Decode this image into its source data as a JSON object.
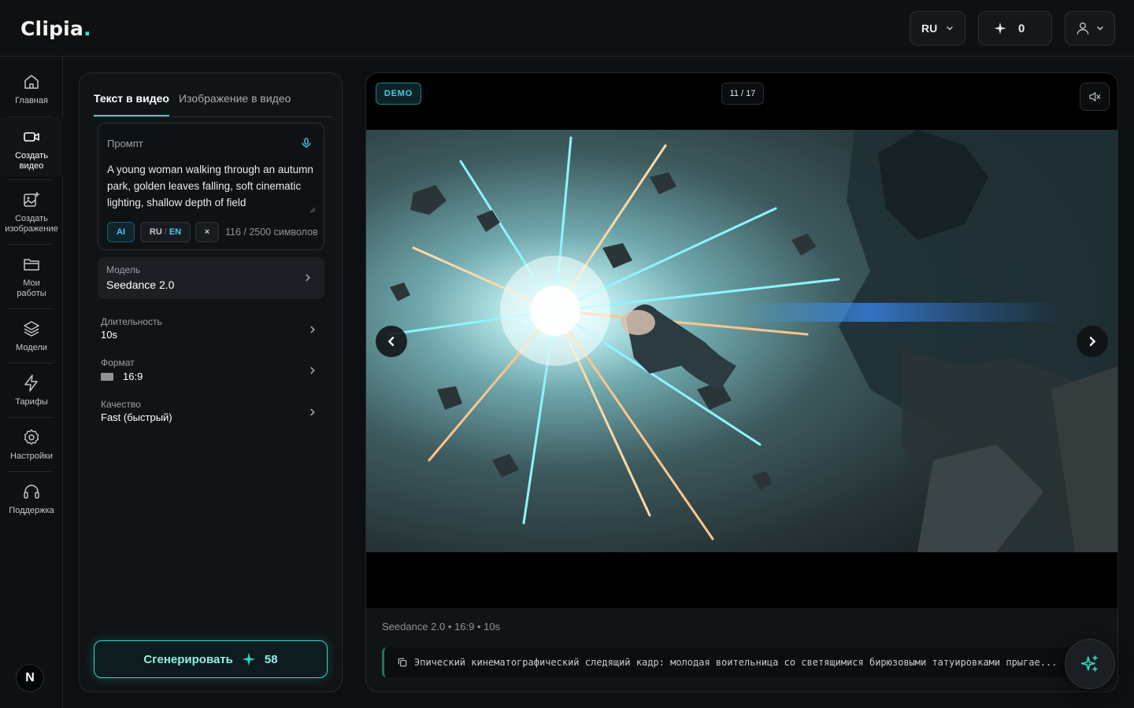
{
  "app": {
    "logo": "Clipia",
    "logo_dot": "."
  },
  "header": {
    "language": "RU",
    "credits": "0",
    "icons": [
      "chevron-down-icon",
      "sparkle-icon",
      "user-icon"
    ]
  },
  "sidebar": {
    "items": [
      {
        "label": "Главная",
        "icon": "home-icon"
      },
      {
        "label": "Создать видео",
        "icon": "video-camera-icon"
      },
      {
        "label": "Создать изображение",
        "icon": "image-add-icon"
      },
      {
        "label": "Мои работы",
        "icon": "folder-icon"
      },
      {
        "label": "Модели",
        "icon": "layers-icon"
      },
      {
        "label": "Тарифы",
        "icon": "lightning-icon"
      },
      {
        "label": "Настройки",
        "icon": "gear-icon"
      },
      {
        "label": "Поддержка",
        "icon": "headset-icon"
      }
    ],
    "avatar": "N"
  },
  "panel": {
    "tabs": [
      {
        "label": "Текст в видео",
        "active": true
      },
      {
        "label": "Изображение в видео",
        "active": false
      }
    ],
    "prompt": {
      "label": "Промпт",
      "text": "A young woman walking through an autumn park, golden leaves falling, soft cinematic lighting, shallow depth of field",
      "chips": {
        "ai": "AI",
        "ru": "RU",
        "sep": "/",
        "en": "EN",
        "clear": "×"
      },
      "char_count": "116 / 2500 символов"
    },
    "model": {
      "label": "Модель",
      "value": "Seedance 2.0"
    },
    "settings": [
      {
        "label": "Длительность",
        "value": "10s"
      },
      {
        "label": "Формат",
        "value": "16:9"
      },
      {
        "label": "Качество",
        "value": "Fast (быстрый)"
      }
    ],
    "generate": {
      "label": "Сгенерировать",
      "cost": "58"
    }
  },
  "viewer": {
    "badge": "DEMO",
    "counter": "11 / 17",
    "meta": "Seedance 2.0 • 16:9 • 10s",
    "description": "Эпический кинематографический следящий кадр: молодая воительница со светящимися бирюзовыми татуировками прыгае..."
  },
  "colors": {
    "accent": "#2fd6c0",
    "info": "#48c8f0",
    "background": "#0d0f11",
    "panel": "#111417"
  }
}
